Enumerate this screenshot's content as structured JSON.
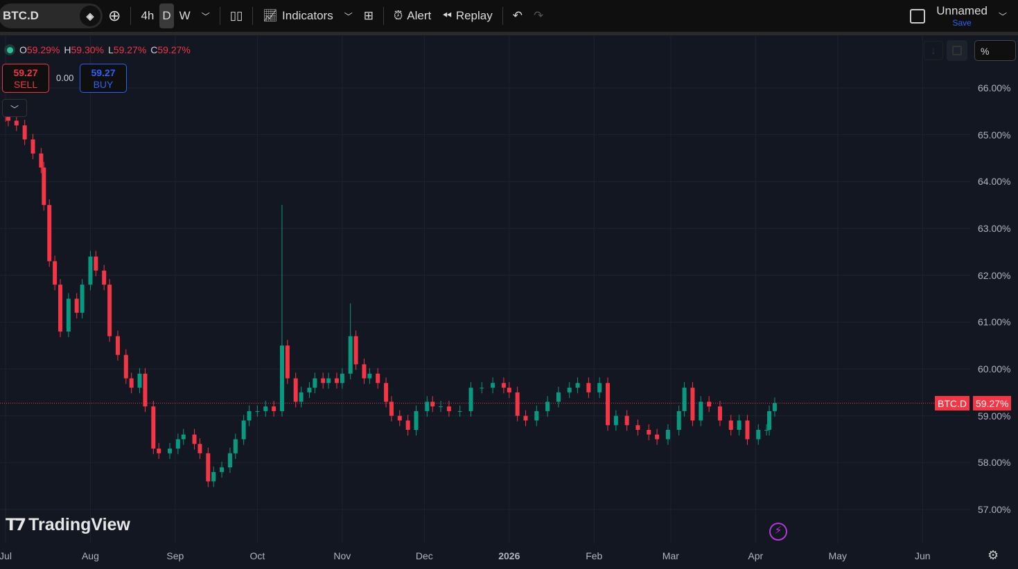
{
  "toolbar": {
    "symbol": "BTC.D",
    "intervals": [
      "4h",
      "D",
      "W"
    ],
    "active_interval": "D",
    "indicators_label": "Indicators",
    "alert_label": "Alert",
    "replay_label": "Replay",
    "layout_name": "Unnamed",
    "save_label": "Save"
  },
  "legend": {
    "o_label": "O",
    "o": "59.29%",
    "h_label": "H",
    "h": "59.30%",
    "l_label": "L",
    "l": "59.27%",
    "c_label": "C",
    "c": "59.27%"
  },
  "trade": {
    "sell_price": "59.27",
    "sell_label": "SELL",
    "spread": "0.00",
    "buy_price": "59.27",
    "buy_label": "BUY"
  },
  "scale_mode": "%",
  "price_tag": {
    "symbol": "BTC.D",
    "value": "59.27%"
  },
  "brand": "TradingView",
  "colors": {
    "up": "#089981",
    "down": "#f23645",
    "bg": "#131722"
  },
  "chart_data": {
    "type": "candlestick",
    "title": "BTC.D",
    "ylim": [
      56.5,
      66.5
    ],
    "y_ticks": [
      "66.00%",
      "65.00%",
      "64.00%",
      "63.00%",
      "62.00%",
      "61.00%",
      "60.00%",
      "59.00%",
      "58.00%",
      "57.00%"
    ],
    "y_tick_values": [
      66,
      65,
      64,
      63,
      62,
      61,
      60,
      59,
      58,
      57
    ],
    "x_ticks": [
      "Jul",
      "Aug",
      "Sep",
      "Oct",
      "Nov",
      "Dec",
      "2026",
      "Feb",
      "Mar",
      "Apr",
      "May",
      "Jun"
    ],
    "x_tick_days": [
      0,
      31,
      62,
      92,
      123,
      153,
      184,
      215,
      243,
      274,
      304,
      335
    ],
    "last_price": 59.27,
    "candles_day_close": [
      [
        0,
        65.4
      ],
      [
        1,
        65.3
      ],
      [
        4,
        65.2
      ],
      [
        7,
        64.9
      ],
      [
        10,
        64.6
      ],
      [
        13,
        64.3
      ],
      [
        14,
        63.5
      ],
      [
        16,
        62.3
      ],
      [
        18,
        61.8
      ],
      [
        20,
        60.8
      ],
      [
        23,
        61.5
      ],
      [
        26,
        61.2
      ],
      [
        28,
        61.8
      ],
      [
        31,
        62.4
      ],
      [
        33,
        62.1
      ],
      [
        36,
        61.8
      ],
      [
        38,
        60.7
      ],
      [
        41,
        60.3
      ],
      [
        44,
        59.8
      ],
      [
        46,
        59.6
      ],
      [
        49,
        59.9
      ],
      [
        51,
        59.2
      ],
      [
        54,
        58.3
      ],
      [
        56,
        58.2
      ],
      [
        60,
        58.3
      ],
      [
        63,
        58.5
      ],
      [
        65,
        58.6
      ],
      [
        69,
        58.4
      ],
      [
        71,
        58.2
      ],
      [
        74,
        57.6
      ],
      [
        76,
        57.8
      ],
      [
        79,
        57.9
      ],
      [
        82,
        58.2
      ],
      [
        84,
        58.5
      ],
      [
        87,
        58.9
      ],
      [
        89,
        59.1
      ],
      [
        92,
        59.1
      ],
      [
        95,
        59.2
      ],
      [
        98,
        59.1
      ],
      [
        101,
        60.5,
        63.5
      ],
      [
        103,
        59.8
      ],
      [
        106,
        59.3
      ],
      [
        108,
        59.5
      ],
      [
        111,
        59.6
      ],
      [
        113,
        59.8
      ],
      [
        116,
        59.7
      ],
      [
        118,
        59.8
      ],
      [
        121,
        59.7
      ],
      [
        123,
        59.9
      ],
      [
        126,
        60.7,
        61.4
      ],
      [
        128,
        60.1
      ],
      [
        131,
        59.8
      ],
      [
        133,
        59.9
      ],
      [
        136,
        59.7
      ],
      [
        139,
        59.3
      ],
      [
        141,
        59.0
      ],
      [
        144,
        58.9
      ],
      [
        147,
        58.7
      ],
      [
        150,
        59.1
      ],
      [
        154,
        59.3
      ],
      [
        156,
        59.2
      ],
      [
        159,
        59.2
      ],
      [
        162,
        59.1
      ],
      [
        166,
        59.1
      ],
      [
        170,
        59.6
      ],
      [
        174,
        59.6
      ],
      [
        178,
        59.7
      ],
      [
        182,
        59.6
      ],
      [
        184,
        59.5
      ],
      [
        187,
        59.0
      ],
      [
        190,
        58.9
      ],
      [
        194,
        59.1
      ],
      [
        198,
        59.3
      ],
      [
        202,
        59.5
      ],
      [
        206,
        59.6
      ],
      [
        209,
        59.7
      ],
      [
        213,
        59.5
      ],
      [
        217,
        59.7
      ],
      [
        220,
        58.8
      ],
      [
        223,
        59.0
      ],
      [
        227,
        58.8
      ],
      [
        231,
        58.7
      ],
      [
        235,
        58.6
      ],
      [
        238,
        58.5
      ],
      [
        242,
        58.7
      ],
      [
        246,
        59.1
      ],
      [
        248,
        59.6
      ],
      [
        251,
        58.9
      ],
      [
        254,
        59.3
      ],
      [
        257,
        59.2
      ],
      [
        261,
        58.9
      ],
      [
        265,
        58.7
      ],
      [
        268,
        58.9
      ],
      [
        271,
        58.5
      ],
      [
        275,
        58.7
      ],
      [
        278,
        58.7
      ],
      [
        279,
        59.1
      ],
      [
        281,
        59.27
      ]
    ]
  }
}
